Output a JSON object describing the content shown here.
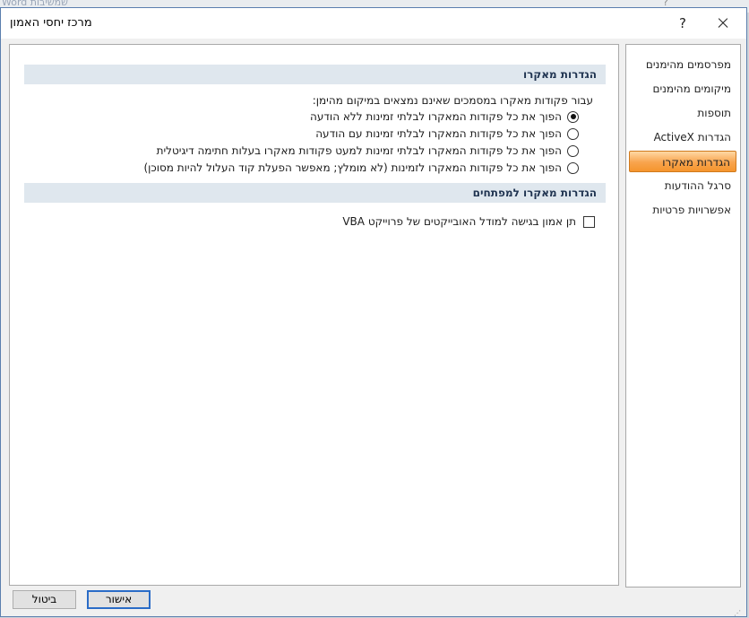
{
  "background": {
    "partial_title": "שמשיבות Word",
    "help_glyph": "?"
  },
  "dialog": {
    "title": "מרכז יחסי האמון",
    "help_label": "?",
    "close_label": ""
  },
  "sidebar": {
    "items": [
      {
        "label": "מפרסמים מהימנים"
      },
      {
        "label": "מיקומים מהימנים"
      },
      {
        "label": "תוספות"
      },
      {
        "label": "הגדרות ActiveX"
      },
      {
        "label": "הגדרות מאקרו"
      },
      {
        "label": "סרגל ההודעות"
      },
      {
        "label": "אפשרויות פרטיות"
      }
    ],
    "selected_index": 4
  },
  "macro_section": {
    "header": "הגדרות מאקרו",
    "intro": "עבור פקודות מאקרו במסמכים שאינם נמצאים במיקום מהימן:",
    "options": [
      {
        "label": "הפוך את כל פקודות המאקרו לבלתי זמינות ללא הודעה",
        "checked": true
      },
      {
        "label": "הפוך את כל פקודות המאקרו לבלתי זמינות עם הודעה",
        "checked": false
      },
      {
        "label": "הפוך את כל פקודות המאקרו לבלתי זמינות למעט פקודות מאקרו בעלות חתימה דיגיטלית",
        "checked": false
      },
      {
        "label": "הפוך את כל פקודות המאקרו לזמינות (לא מומלץ; מאפשר הפעלת קוד העלול להיות מסוכן)",
        "checked": false
      }
    ]
  },
  "developer_section": {
    "header": "הגדרות מאקרו למפתחים",
    "checkbox_label": "תן אמון בגישה למודל האובייקטים של פרוייקט VBA",
    "checked": false
  },
  "footer": {
    "ok_label": "אישור",
    "cancel_label": "ביטול"
  },
  "colors": {
    "accent_selected": "#f8a44d",
    "section_header_bg": "#dfe7ee",
    "default_button_border": "#2a6cc7"
  }
}
